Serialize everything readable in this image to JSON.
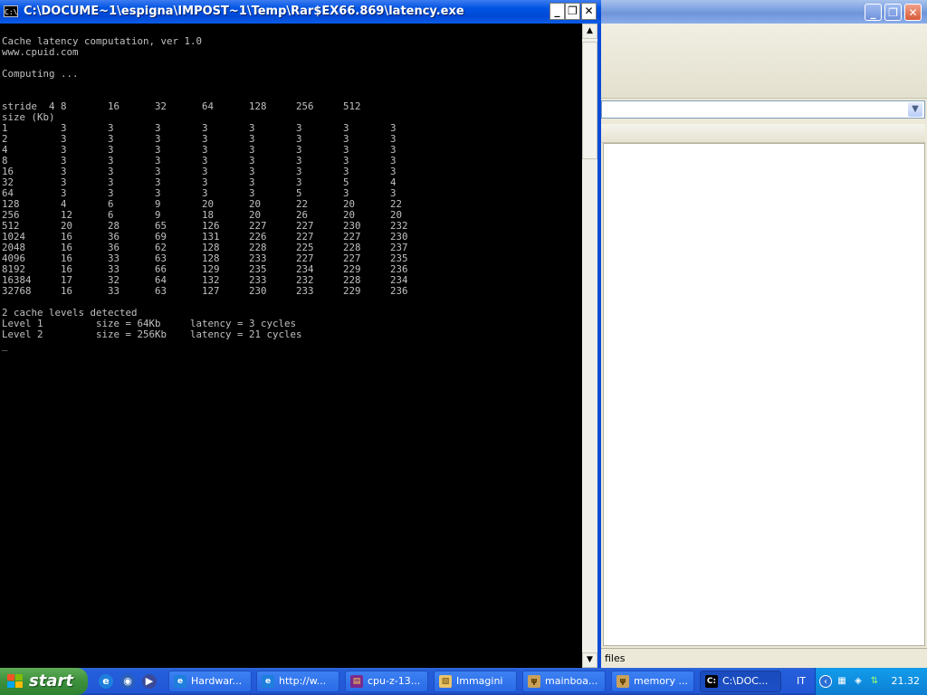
{
  "console": {
    "title": "C:\\DOCUME~1\\espigna\\IMPOST~1\\Temp\\Rar$EX66.869\\latency.exe",
    "icon": "console-icon",
    "header_lines": [
      "Cache latency computation, ver 1.0",
      "www.cpuid.com",
      "",
      "Computing ..."
    ],
    "table": {
      "stride_label": "stride",
      "size_label": "size (Kb)",
      "strides": [
        "4",
        "8",
        "16",
        "32",
        "64",
        "128",
        "256",
        "512"
      ],
      "rows": [
        {
          "size": "1",
          "values": [
            "3",
            "3",
            "3",
            "3",
            "3",
            "3",
            "3",
            "3"
          ]
        },
        {
          "size": "2",
          "values": [
            "3",
            "3",
            "3",
            "3",
            "3",
            "3",
            "3",
            "3"
          ]
        },
        {
          "size": "4",
          "values": [
            "3",
            "3",
            "3",
            "3",
            "3",
            "3",
            "3",
            "3"
          ]
        },
        {
          "size": "8",
          "values": [
            "3",
            "3",
            "3",
            "3",
            "3",
            "3",
            "3",
            "3"
          ]
        },
        {
          "size": "16",
          "values": [
            "3",
            "3",
            "3",
            "3",
            "3",
            "3",
            "3",
            "3"
          ]
        },
        {
          "size": "32",
          "values": [
            "3",
            "3",
            "3",
            "3",
            "3",
            "3",
            "5",
            "4"
          ]
        },
        {
          "size": "64",
          "values": [
            "3",
            "3",
            "3",
            "3",
            "3",
            "5",
            "3",
            "3"
          ]
        },
        {
          "size": "128",
          "values": [
            "4",
            "6",
            "9",
            "20",
            "20",
            "22",
            "20",
            "22"
          ]
        },
        {
          "size": "256",
          "values": [
            "12",
            "6",
            "9",
            "18",
            "20",
            "26",
            "20",
            "20"
          ]
        },
        {
          "size": "512",
          "values": [
            "20",
            "28",
            "65",
            "126",
            "227",
            "227",
            "230",
            "232"
          ]
        },
        {
          "size": "1024",
          "values": [
            "16",
            "36",
            "69",
            "131",
            "226",
            "227",
            "227",
            "230"
          ]
        },
        {
          "size": "2048",
          "values": [
            "16",
            "36",
            "62",
            "128",
            "228",
            "225",
            "228",
            "237"
          ]
        },
        {
          "size": "4096",
          "values": [
            "16",
            "33",
            "63",
            "128",
            "233",
            "227",
            "227",
            "235"
          ]
        },
        {
          "size": "8192",
          "values": [
            "16",
            "33",
            "66",
            "129",
            "235",
            "234",
            "229",
            "236"
          ]
        },
        {
          "size": "16384",
          "values": [
            "17",
            "32",
            "64",
            "132",
            "233",
            "232",
            "228",
            "234"
          ]
        },
        {
          "size": "32768",
          "values": [
            "16",
            "33",
            "63",
            "127",
            "230",
            "233",
            "229",
            "236"
          ]
        }
      ]
    },
    "summary": {
      "detected": "2 cache levels detected",
      "levels": [
        {
          "name": "Level 1",
          "size": "size = 64Kb",
          "latency": "latency = 3 cycles"
        },
        {
          "name": "Level 2",
          "size": "size = 256Kb",
          "latency": "latency = 21 cycles"
        }
      ]
    },
    "cursor": "_"
  },
  "background_window": {
    "status_text": "files"
  },
  "taskbar": {
    "start_label": "start",
    "quick_launch": [
      {
        "icon": "internet-explorer-icon"
      },
      {
        "icon": "firefox-icon"
      },
      {
        "icon": "media-player-icon"
      }
    ],
    "tasks": [
      {
        "label": "Hardwar...",
        "icon": "internet-explorer-icon",
        "active": false
      },
      {
        "label": "http://w...",
        "icon": "internet-explorer-icon",
        "active": false
      },
      {
        "label": "cpu-z-13...",
        "icon": "winrar-icon",
        "active": false
      },
      {
        "label": "Immagini",
        "icon": "image-folder-icon",
        "active": false
      },
      {
        "label": "mainboa...",
        "icon": "app-icon",
        "active": false
      },
      {
        "label": "memory ...",
        "icon": "app-icon",
        "active": false
      },
      {
        "label": "C:\\DOC...",
        "icon": "console-icon",
        "active": true
      }
    ],
    "language": "IT",
    "clock": "21.32"
  },
  "colors": {
    "console_bg": "#000000",
    "console_text": "#c0c0c0",
    "titlebar_blue": "#0054e3",
    "taskbar_blue": "#245edb",
    "start_green": "#3c8f3b",
    "tray_blue": "#0f8ee0"
  }
}
